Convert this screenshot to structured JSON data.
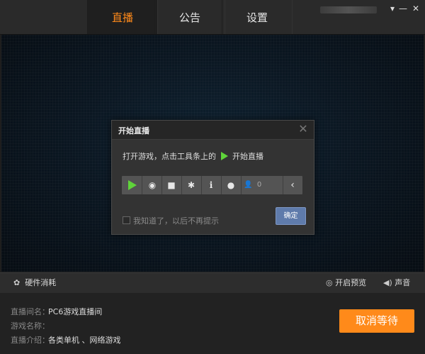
{
  "tabs": [
    {
      "label": "直播",
      "active": true
    },
    {
      "label": "公告",
      "active": false
    },
    {
      "label": "设置",
      "active": false
    }
  ],
  "window": {
    "minimize_icon": "minimize-icon",
    "close_icon": "close-icon",
    "menu_icon": "dropdown-arrow-icon"
  },
  "dialog": {
    "title": "开始直播",
    "message_prefix": "打开游戏，点击工具条上的",
    "message_suffix": "开始直播",
    "toolbar": {
      "icons": [
        "play-icon",
        "record-icon",
        "camera-icon",
        "settings-icon",
        "info-icon",
        "chat-icon",
        "viewer-icon",
        "collapse-icon"
      ],
      "viewer_count": "0"
    },
    "checkbox_label": "我知道了，以后不再提示",
    "checked": false,
    "ok_label": "确定"
  },
  "status_bar": {
    "hardware_label": "硬件消耗",
    "preview_label": "开启预览",
    "sound_label": "声音"
  },
  "info": {
    "room_key": "直播间名：",
    "room_value": "PC6游戏直播间",
    "game_key": "游戏名称：",
    "game_value": "",
    "intro_key": "直播介绍：",
    "intro_value": "各类单机 、网络游戏"
  },
  "cancel_label": "取消等待",
  "colors": {
    "accent": "#ff8a1a",
    "play_green": "#5fd43a",
    "ok_button": "#5f7bab"
  }
}
